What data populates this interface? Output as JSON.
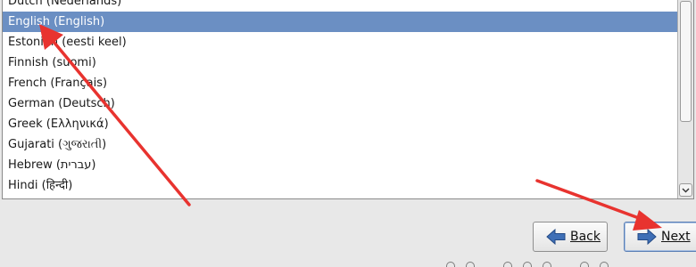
{
  "language_list": {
    "items": [
      {
        "label": "Dutch (Nederlands)",
        "selected": false
      },
      {
        "label": "English (English)",
        "selected": true
      },
      {
        "label": "Estonian (eesti keel)",
        "selected": false
      },
      {
        "label": "Finnish (suomi)",
        "selected": false
      },
      {
        "label": "French (Français)",
        "selected": false
      },
      {
        "label": "German (Deutsch)",
        "selected": false
      },
      {
        "label": "Greek (Ελληνικά)",
        "selected": false
      },
      {
        "label": "Gujarati (ગુજરાતી)",
        "selected": false
      },
      {
        "label": "Hebrew (עברית)",
        "selected": false
      },
      {
        "label": "Hindi (हिन्दी)",
        "selected": false
      }
    ]
  },
  "buttons": {
    "back_label": "Back",
    "next_label": "Next"
  },
  "icons": {
    "back": "arrow-left-icon",
    "next": "arrow-right-icon",
    "scroll_down": "chevron-down-icon"
  },
  "colors": {
    "selection": "#6b8fc3",
    "nav_arrow": "#3f6fb6",
    "annotation_arrow": "#e8332f"
  }
}
